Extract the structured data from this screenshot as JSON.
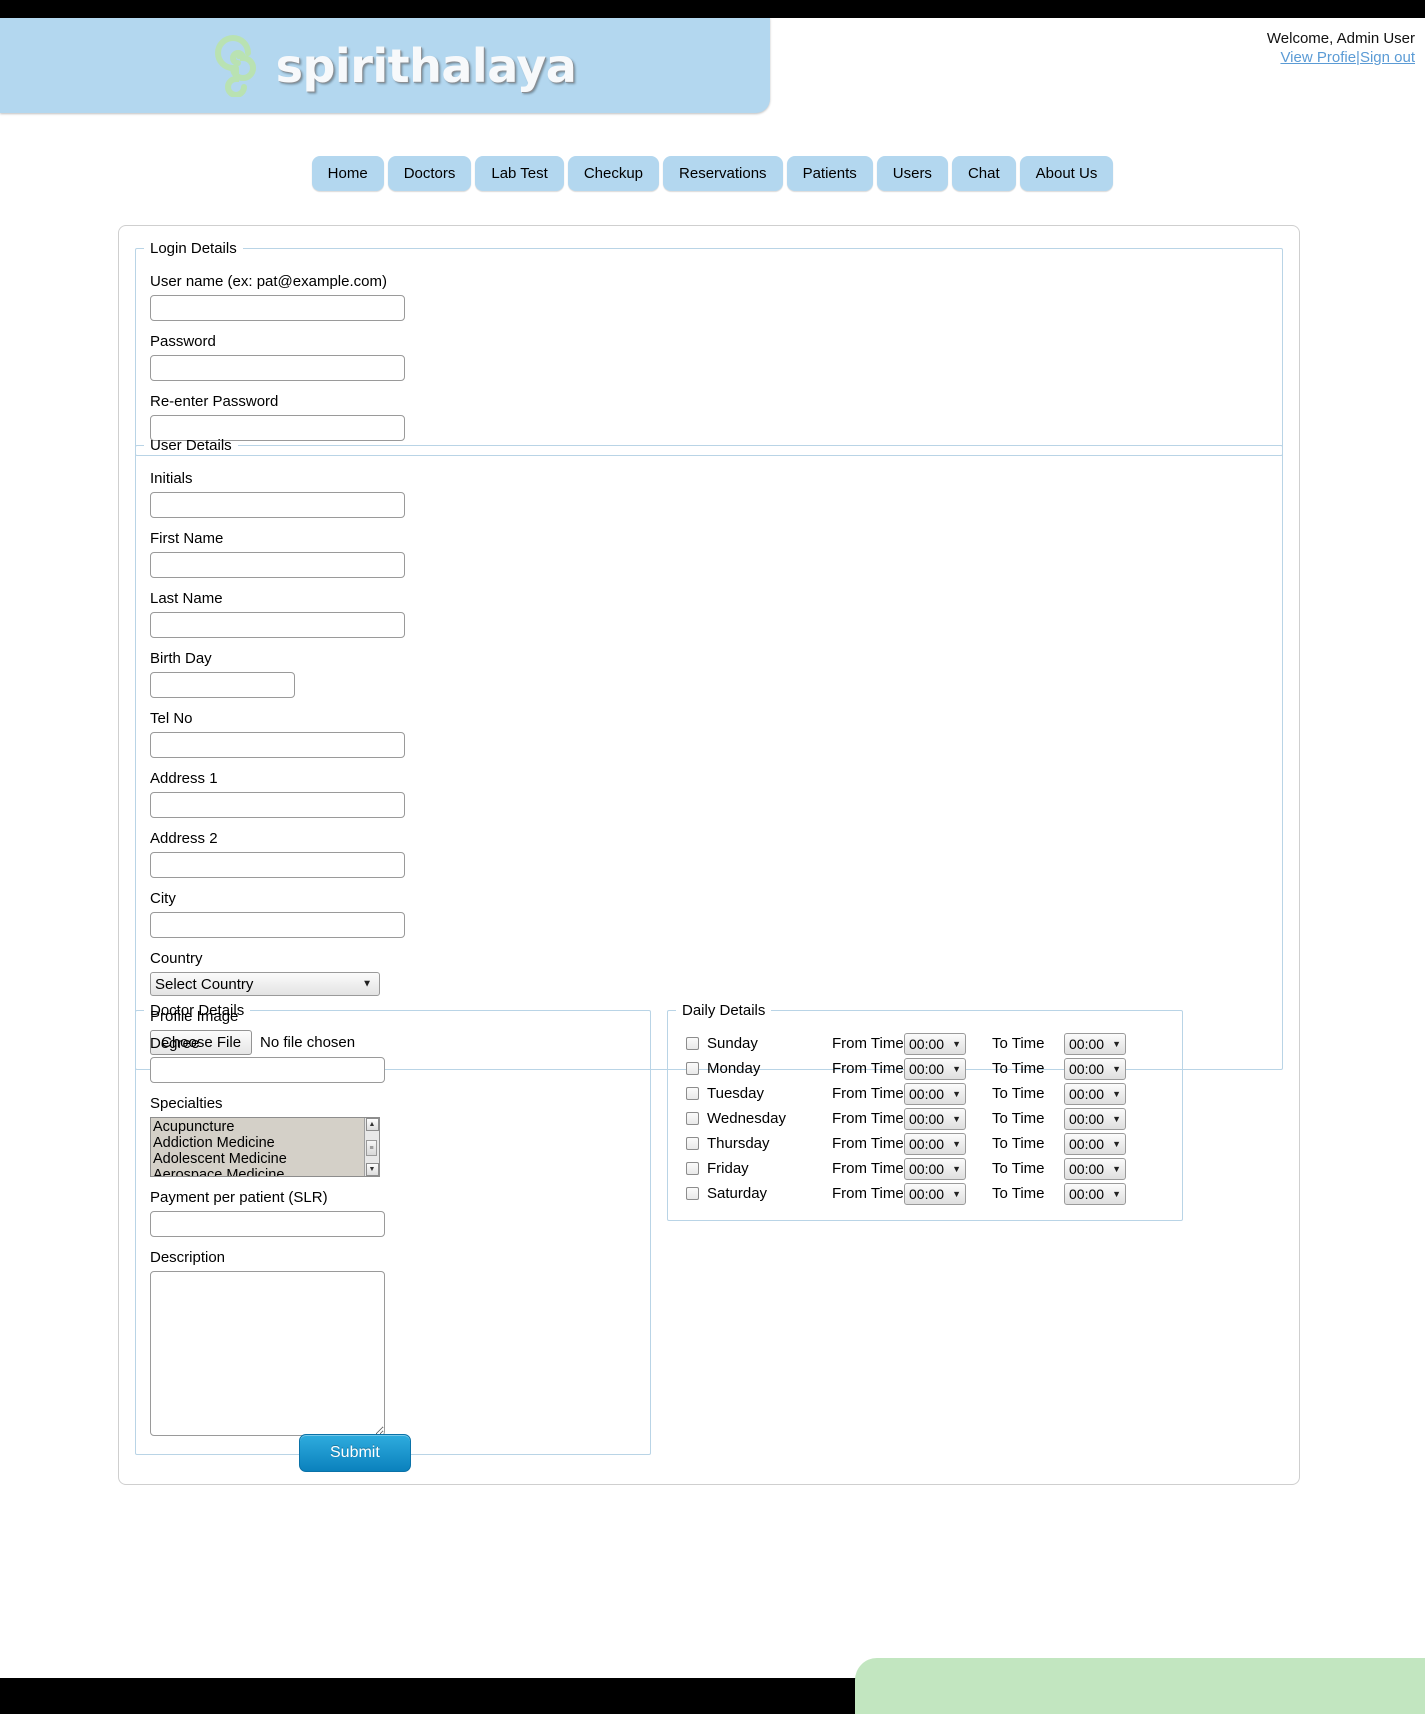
{
  "brand": {
    "name": "spirithalaya",
    "logo_icon": "spiral-ear-logo-icon",
    "header_bg": "#b3d7ef",
    "accent": "#0b81bd",
    "footer_bg": "#c2e6c0"
  },
  "user_bar": {
    "welcome": "Welcome, Admin User",
    "view_profile": "View Profie",
    "separator": "|",
    "sign_out": "Sign out"
  },
  "nav": {
    "tabs": [
      {
        "label": "Home"
      },
      {
        "label": "Doctors"
      },
      {
        "label": "Lab Test"
      },
      {
        "label": "Checkup"
      },
      {
        "label": "Reservations"
      },
      {
        "label": "Patients"
      },
      {
        "label": "Users"
      },
      {
        "label": "Chat"
      },
      {
        "label": "About Us"
      }
    ]
  },
  "login_details": {
    "legend": "Login Details",
    "fields": [
      {
        "label": "User name (ex: pat@example.com)",
        "value": "",
        "placeholder": ""
      },
      {
        "label": "Password",
        "value": "",
        "placeholder": ""
      },
      {
        "label": "Re-enter Password",
        "value": "",
        "placeholder": ""
      }
    ]
  },
  "user_details": {
    "legend": "User Details",
    "fields": [
      {
        "label": "Initials",
        "value": ""
      },
      {
        "label": "First Name",
        "value": ""
      },
      {
        "label": "Last Name",
        "value": ""
      },
      {
        "label": "Birth Day",
        "value": ""
      },
      {
        "label": "Tel No",
        "value": ""
      },
      {
        "label": "Address 1",
        "value": ""
      },
      {
        "label": "Address 2",
        "value": ""
      },
      {
        "label": "City",
        "value": ""
      }
    ],
    "country": {
      "label": "Country",
      "selected": "Select Country",
      "options": [
        "Select Country"
      ]
    },
    "profile_image": {
      "label": "Profile Image",
      "button": "Choose File",
      "status": "No file chosen"
    }
  },
  "doctor_details": {
    "legend": "Doctor Details",
    "degree": {
      "label": "Degree",
      "value": ""
    },
    "specialties": {
      "label": "Specialties",
      "options": [
        "Acupuncture",
        "Addiction Medicine",
        "Adolescent Medicine",
        "Aerospace Medicine"
      ]
    },
    "payment": {
      "label": "Payment per patient (SLR)",
      "value": ""
    },
    "description": {
      "label": "Description",
      "value": ""
    }
  },
  "daily_details": {
    "legend": "Daily Details",
    "from_label": "From Time",
    "to_label": "To Time",
    "default_time": "00:00",
    "rows": [
      {
        "day": "Sunday",
        "checked": false,
        "from": "00:00",
        "to": "00:00"
      },
      {
        "day": "Monday",
        "checked": false,
        "from": "00:00",
        "to": "00:00"
      },
      {
        "day": "Tuesday",
        "checked": false,
        "from": "00:00",
        "to": "00:00"
      },
      {
        "day": "Wednesday",
        "checked": false,
        "from": "00:00",
        "to": "00:00"
      },
      {
        "day": "Thursday",
        "checked": false,
        "from": "00:00",
        "to": "00:00"
      },
      {
        "day": "Friday",
        "checked": false,
        "from": "00:00",
        "to": "00:00"
      },
      {
        "day": "Saturday",
        "checked": false,
        "from": "00:00",
        "to": "00:00"
      }
    ]
  },
  "actions": {
    "submit_label": "Submit"
  }
}
